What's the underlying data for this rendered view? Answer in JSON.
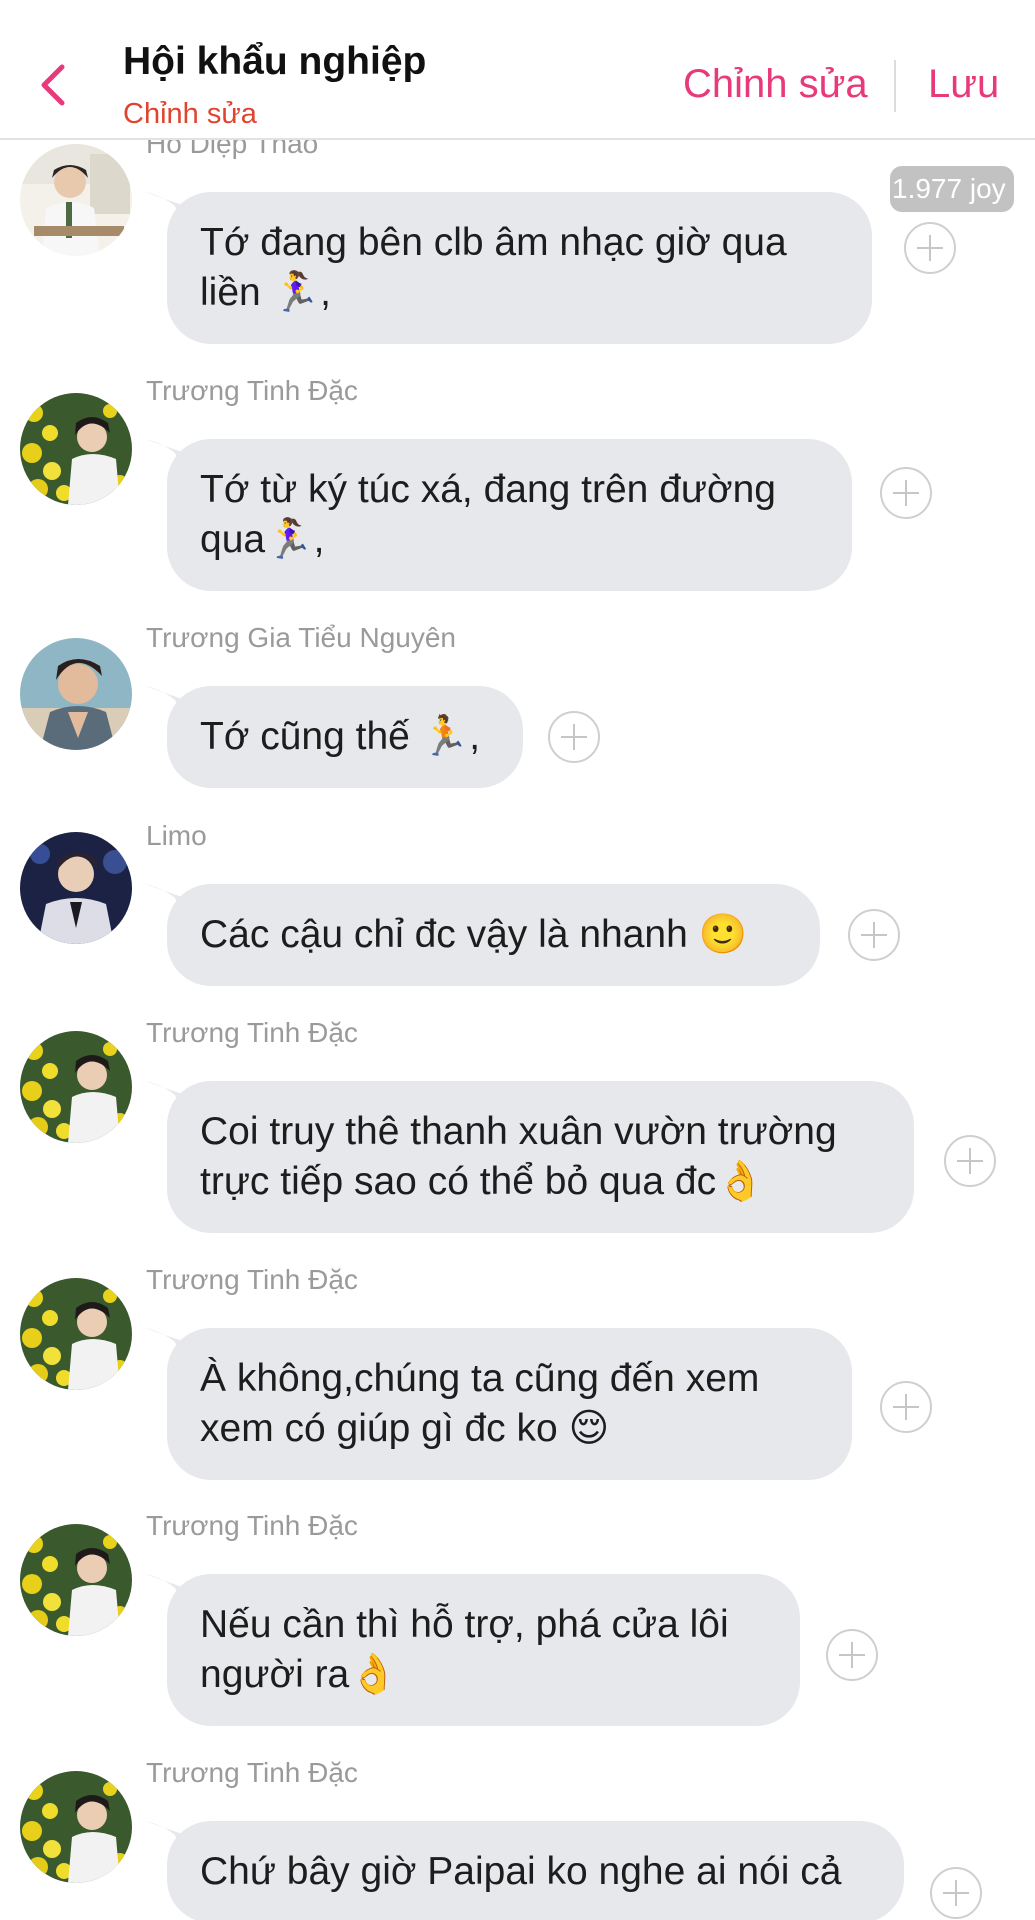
{
  "header": {
    "title": "Hội khẩu nghiệp",
    "subtitle": "Chỉnh sửa",
    "edit_label": "Chỉnh sửa",
    "save_label": "Lưu"
  },
  "colors": {
    "accent": "#e8397a",
    "subtitle": "#e0442f",
    "bubble": "#e6e8ec",
    "sender": "#9a9a9a"
  },
  "joy_badge": "1.977 joy",
  "messages": [
    {
      "sender": "Hồ Diệp Thao",
      "avatar": "avatar-ho-diep-thao",
      "lines": [
        "Tớ  đang bên clb âm nhạc giờ qua",
        "liền 🏃‍♀️,"
      ]
    },
    {
      "sender": "Trương Tinh Đặc",
      "avatar": "avatar-truong-tinh-dac",
      "lines": [
        "Tớ từ ký túc xá, đang trên đường",
        "qua🏃‍♀️,"
      ]
    },
    {
      "sender": "Trương Gia Tiểu Nguyên",
      "avatar": "avatar-truong-gia-tieu-nguyen",
      "lines": [
        "Tớ cũng thế 🏃,"
      ]
    },
    {
      "sender": "Limo",
      "avatar": "avatar-limo",
      "lines": [
        "Các cậu chỉ đc vậy là nhanh 🙂"
      ]
    },
    {
      "sender": "Trương Tinh Đặc",
      "avatar": "avatar-truong-tinh-dac",
      "lines": [
        "Coi truy thê thanh xuân vườn trường",
        "trực tiếp sao có thể bỏ qua đc👌"
      ]
    },
    {
      "sender": "Trương Tinh Đặc",
      "avatar": "avatar-truong-tinh-dac",
      "lines": [
        "À không,chúng ta cũng đến xem",
        "xem có giúp gì đc ko 😌"
      ]
    },
    {
      "sender": "Trương Tinh Đặc",
      "avatar": "avatar-truong-tinh-dac",
      "lines": [
        "Nếu cần thì hỗ trợ, phá cửa lôi",
        "người ra👌"
      ]
    },
    {
      "sender": "Trương Tinh Đặc",
      "avatar": "avatar-truong-tinh-dac",
      "lines": [
        "Chứ bây giờ Paipai ko nghe ai nói cả"
      ]
    }
  ]
}
